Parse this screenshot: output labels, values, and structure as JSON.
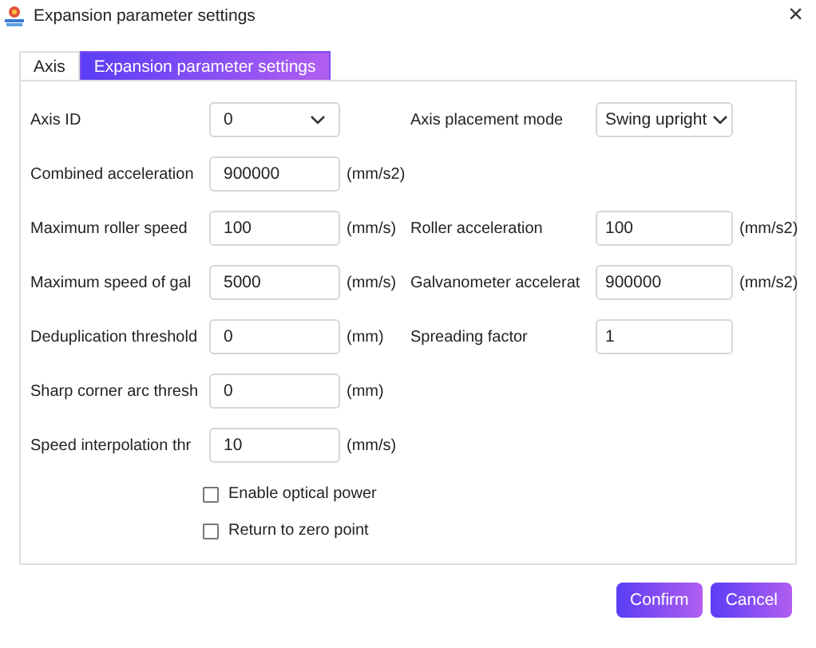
{
  "window": {
    "title": "Expansion parameter settings",
    "close": "×"
  },
  "tabs": [
    {
      "label": "Axis",
      "selected": false
    },
    {
      "label": "Expansion parameter settings",
      "selected": true
    }
  ],
  "rows": [
    {
      "left": {
        "kind": "select",
        "label": "Axis ID",
        "value": "0"
      },
      "right": {
        "kind": "select",
        "label": "Axis placement mode",
        "value": "Swing upright"
      }
    },
    {
      "left": {
        "kind": "input",
        "label": "Combined acceleration",
        "value": "900000",
        "unit": "(mm/s2)"
      }
    },
    {
      "left": {
        "kind": "input",
        "label": "Maximum roller speed",
        "value": "100",
        "unit": "(mm/s)"
      },
      "right": {
        "kind": "input",
        "label": "Roller acceleration",
        "value": "100",
        "unit": "(mm/s2)"
      }
    },
    {
      "left": {
        "kind": "input",
        "label": "Maximum speed of gal",
        "value": "5000",
        "unit": "(mm/s)"
      },
      "right": {
        "kind": "input",
        "label": "Galvanometer accelerat",
        "value": "900000",
        "unit": "(mm/s2)"
      }
    },
    {
      "left": {
        "kind": "input",
        "label": "Deduplication threshold",
        "value": "0",
        "unit": "(mm)"
      },
      "right": {
        "kind": "input",
        "label": "Spreading factor",
        "value": "1"
      }
    },
    {
      "left": {
        "kind": "input",
        "label": "Sharp corner arc thresh",
        "value": "0",
        "unit": "(mm)"
      }
    },
    {
      "left": {
        "kind": "input",
        "label": "Speed interpolation thr",
        "value": "10",
        "unit": "(mm/s)"
      }
    }
  ],
  "checkboxes": [
    {
      "label": "Enable optical power",
      "checked": false
    },
    {
      "label": "Return to zero point",
      "checked": false
    }
  ],
  "buttons": [
    "Confirm",
    "Cancel"
  ]
}
